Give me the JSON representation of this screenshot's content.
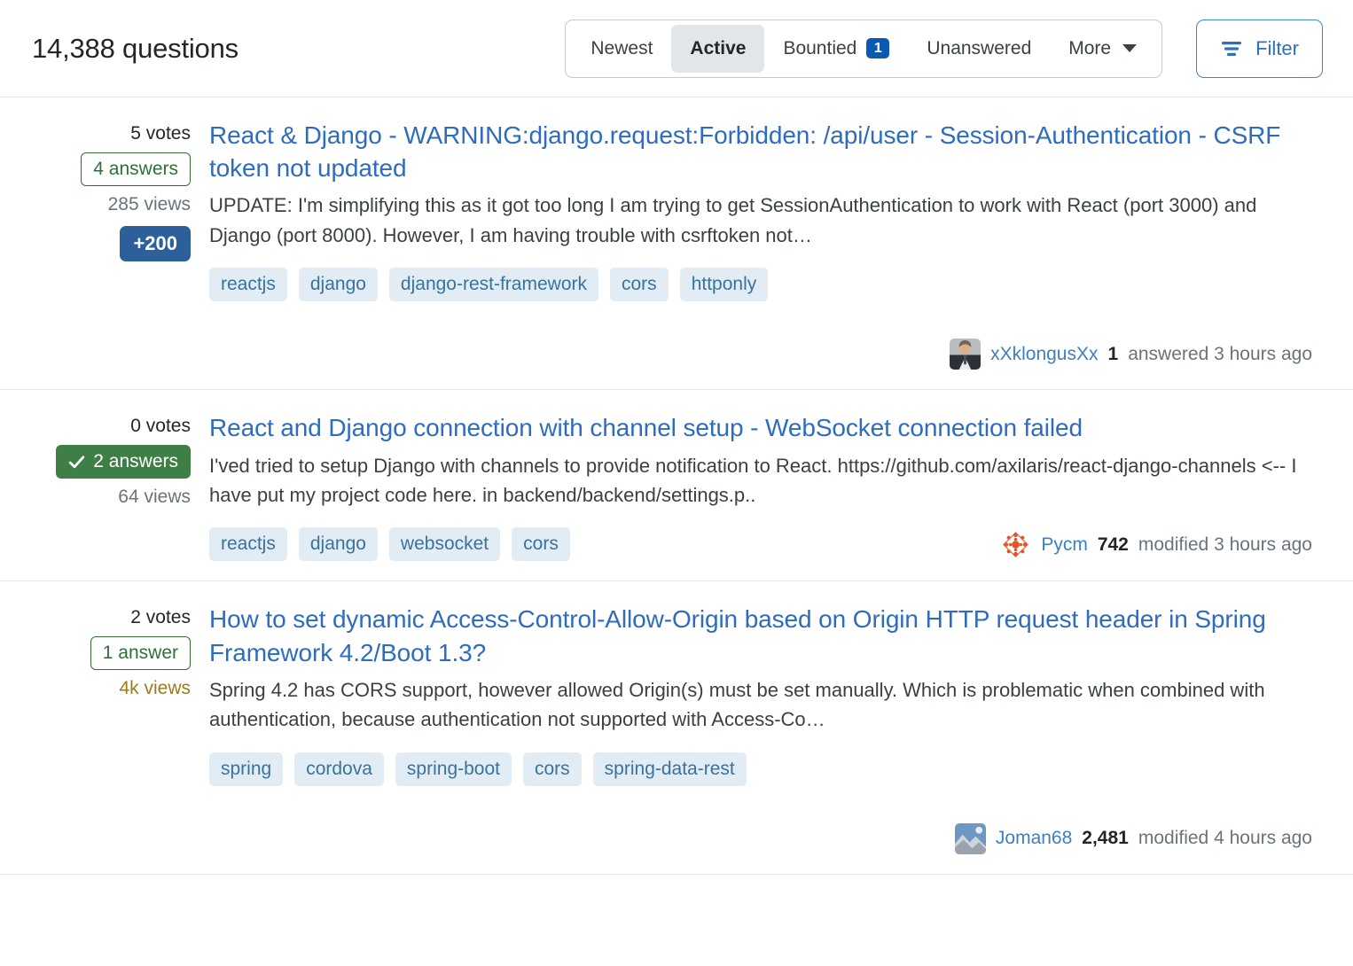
{
  "header": {
    "question_count": "14,388 questions",
    "tabs": [
      {
        "label": "Newest",
        "selected": false,
        "badge": null
      },
      {
        "label": "Active",
        "selected": true,
        "badge": null
      },
      {
        "label": "Bountied",
        "selected": false,
        "badge": "1"
      },
      {
        "label": "Unanswered",
        "selected": false,
        "badge": null
      },
      {
        "label": "More",
        "selected": false,
        "badge": null,
        "caret": true
      }
    ],
    "filter_label": "Filter",
    "filter_icon": "filter-icon",
    "accent_color": "#2f6fc0",
    "badge_color": "#0a5ab3"
  },
  "questions": [
    {
      "votes": "5 votes",
      "answers": "4 answers",
      "answer_accepted": false,
      "views": "285 views",
      "views_hot": false,
      "bounty": "+200",
      "title": "React & Django - WARNING:django.request:Forbidden: /api/user - Session-Authentication - CSRF token not updated",
      "excerpt": "UPDATE: I'm simplifying this as it got too long I am trying to get SessionAuthentication to work with React (port 3000) and Django (port 8000). However, I am having trouble with csrftoken not…",
      "tags": [
        "reactjs",
        "django",
        "django-rest-framework",
        "cors",
        "httponly"
      ],
      "user": {
        "name": "xXklongusXx",
        "reputation": "1",
        "action": "answered 3 hours ago",
        "avatar": "photo-person-suit"
      },
      "user_position": "below"
    },
    {
      "votes": "0 votes",
      "answers": "2 answers",
      "answer_accepted": true,
      "views": "64 views",
      "views_hot": false,
      "bounty": null,
      "title": "React and Django connection with channel setup - WebSocket connection failed",
      "excerpt": "I'ved tried to setup Django with channels to provide notification to React. https://github.com/axilaris/react-django-channels <-- I have put my project code here. in backend/backend/settings.p..",
      "tags": [
        "reactjs",
        "django",
        "websocket",
        "cors"
      ],
      "user": {
        "name": "Pycm",
        "reputation": "742",
        "action": "modified 3 hours ago",
        "avatar": "geometric-orange"
      },
      "user_position": "inline"
    },
    {
      "votes": "2 votes",
      "answers": "1 answer",
      "answer_accepted": false,
      "views": "4k views",
      "views_hot": true,
      "bounty": null,
      "title": "How to set dynamic Access-Control-Allow-Origin based on Origin HTTP request header in Spring Framework 4.2/Boot 1.3?",
      "excerpt": "Spring 4.2 has CORS support, however allowed Origin(s) must be set manually. Which is problematic when combined with authentication, because authentication not supported with Access-Co…",
      "tags": [
        "spring",
        "cordova",
        "spring-boot",
        "cors",
        "spring-data-rest"
      ],
      "user": {
        "name": "Joman68",
        "reputation": "2,481",
        "action": "modified 4 hours ago",
        "avatar": "photo-landscape"
      },
      "user_position": "below"
    }
  ]
}
